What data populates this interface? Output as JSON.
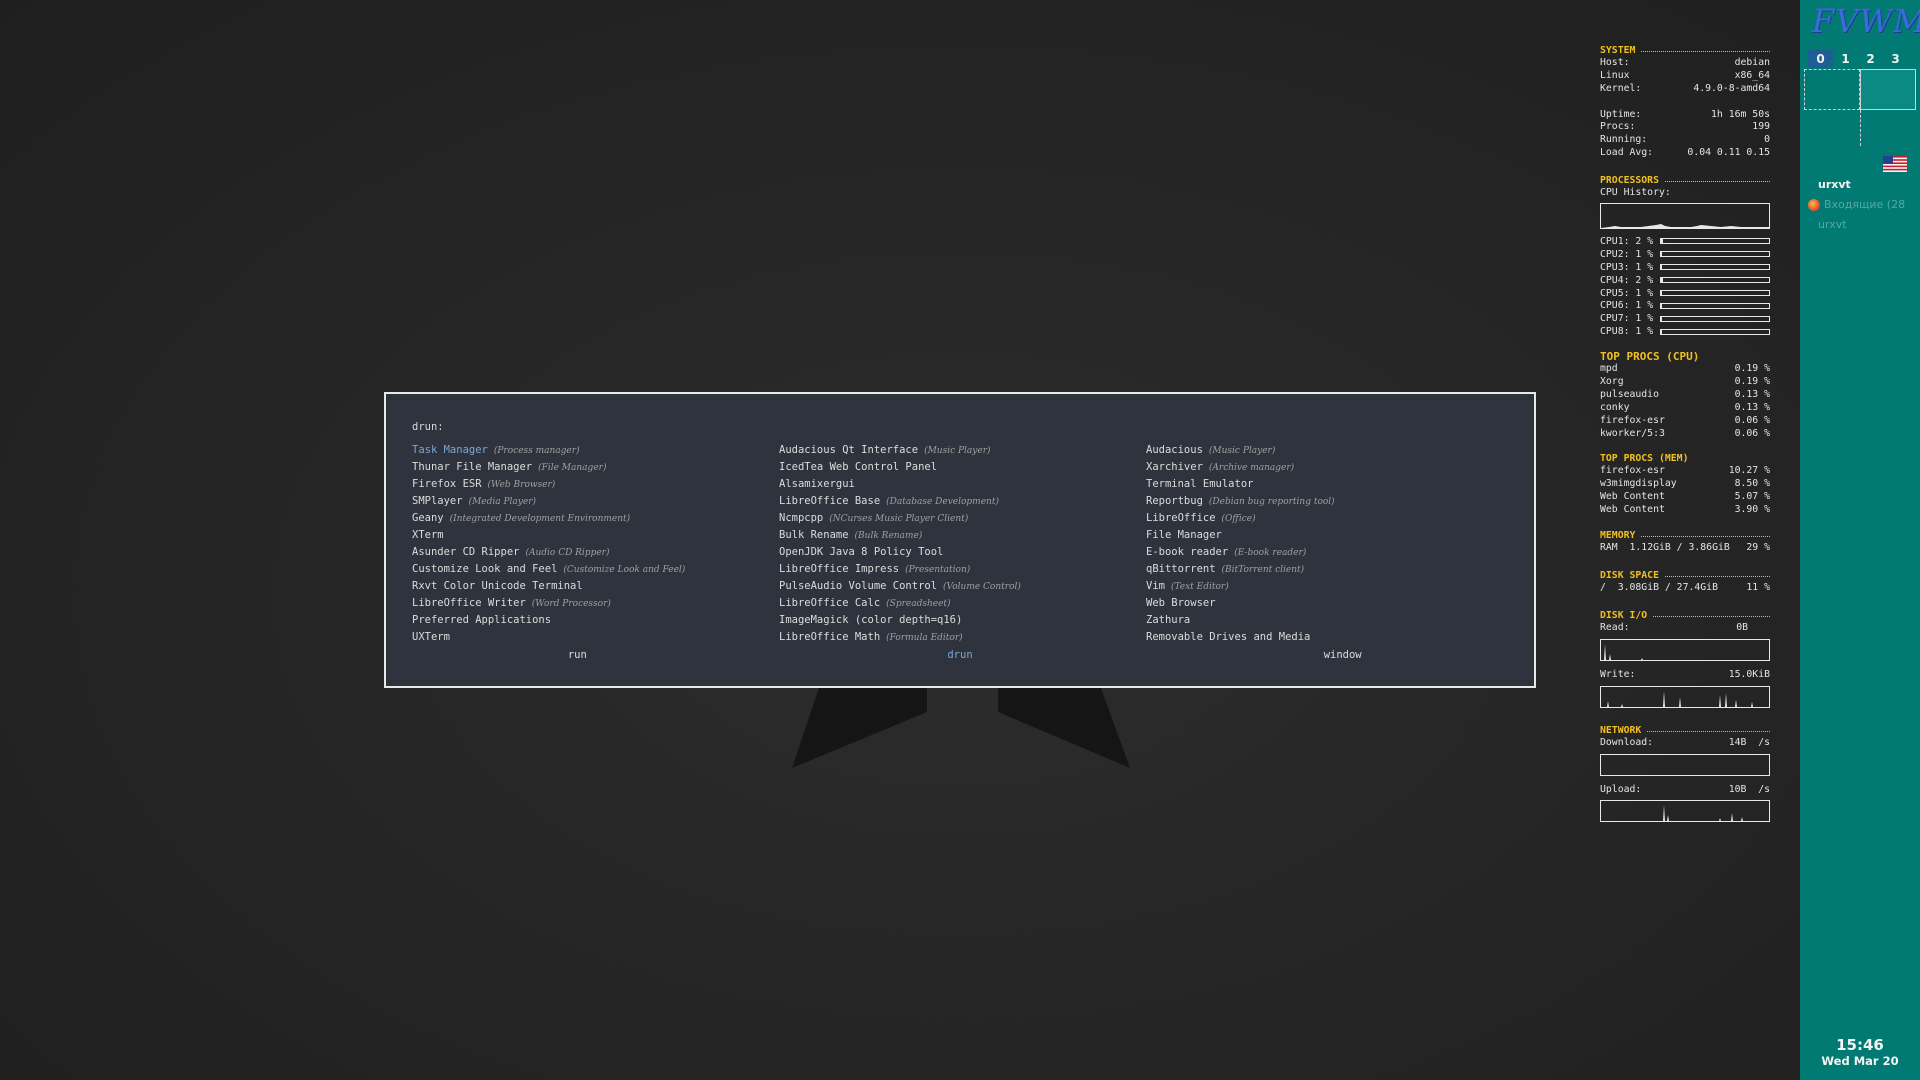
{
  "rofi": {
    "prompt": "drun:",
    "items": [
      {
        "name": "Task Manager",
        "desc": "(Process manager)",
        "selected": true
      },
      {
        "name": "Thunar File Manager",
        "desc": "(File Manager)"
      },
      {
        "name": "Firefox ESR",
        "desc": "(Web Browser)"
      },
      {
        "name": "SMPlayer",
        "desc": "(Media Player)"
      },
      {
        "name": "Geany",
        "desc": "(Integrated Development Environment)"
      },
      {
        "name": "XTerm",
        "desc": ""
      },
      {
        "name": "Asunder CD Ripper",
        "desc": "(Audio CD Ripper)"
      },
      {
        "name": "Customize Look and Feel",
        "desc": "(Customize Look and Feel)"
      },
      {
        "name": "Rxvt Color Unicode Terminal",
        "desc": ""
      },
      {
        "name": "LibreOffice Writer",
        "desc": "(Word Processor)"
      },
      {
        "name": "Preferred Applications",
        "desc": ""
      },
      {
        "name": "UXTerm",
        "desc": ""
      },
      {
        "name": "Audacious Qt Interface",
        "desc": "(Music Player)"
      },
      {
        "name": "IcedTea Web Control Panel",
        "desc": ""
      },
      {
        "name": "Alsamixergui",
        "desc": ""
      },
      {
        "name": "LibreOffice Base",
        "desc": "(Database Development)"
      },
      {
        "name": "Ncmpcpp",
        "desc": "(NCurses Music Player Client)"
      },
      {
        "name": "Bulk Rename",
        "desc": "(Bulk Rename)"
      },
      {
        "name": "OpenJDK Java 8 Policy Tool",
        "desc": ""
      },
      {
        "name": "LibreOffice Impress",
        "desc": "(Presentation)"
      },
      {
        "name": "PulseAudio Volume Control",
        "desc": "(Volume Control)"
      },
      {
        "name": "LibreOffice Calc",
        "desc": "(Spreadsheet)"
      },
      {
        "name": "ImageMagick (color depth=q16)",
        "desc": ""
      },
      {
        "name": "LibreOffice Math",
        "desc": "(Formula Editor)"
      },
      {
        "name": "Audacious",
        "desc": "(Music Player)"
      },
      {
        "name": "Xarchiver",
        "desc": "(Archive manager)"
      },
      {
        "name": "Terminal Emulator",
        "desc": ""
      },
      {
        "name": "Reportbug",
        "desc": "(Debian bug reporting tool)"
      },
      {
        "name": "LibreOffice",
        "desc": "(Office)"
      },
      {
        "name": "File Manager",
        "desc": ""
      },
      {
        "name": "E-book reader",
        "desc": "(E-book reader)"
      },
      {
        "name": "qBittorrent",
        "desc": "(BitTorrent client)"
      },
      {
        "name": "Vim",
        "desc": "(Text Editor)"
      },
      {
        "name": "Web Browser",
        "desc": ""
      },
      {
        "name": "Zathura",
        "desc": ""
      },
      {
        "name": "Removable Drives and Media",
        "desc": ""
      }
    ],
    "modes": [
      {
        "label": "run",
        "active": false
      },
      {
        "label": "drun",
        "active": true
      },
      {
        "label": "window",
        "active": false
      }
    ]
  },
  "conky": {
    "system": {
      "title": "SYSTEM",
      "rows": [
        [
          "Host:",
          "debian"
        ],
        [
          "Linux",
          "x86_64"
        ],
        [
          "Kernel:",
          "4.9.0-8-amd64"
        ]
      ],
      "rows2": [
        [
          "Uptime:",
          "1h 16m 50s"
        ],
        [
          "Procs:",
          "199"
        ],
        [
          "Running:",
          "0"
        ],
        [
          "Load Avg:",
          "0.04 0.11 0.15"
        ]
      ]
    },
    "processors": {
      "title": "PROCESSORS",
      "history_label": "CPU History:",
      "cpus": [
        {
          "label": "CPU1:",
          "value": "2 %",
          "pct": 2
        },
        {
          "label": "CPU2:",
          "value": "1 %",
          "pct": 1
        },
        {
          "label": "CPU3:",
          "value": "1 %",
          "pct": 1
        },
        {
          "label": "CPU4:",
          "value": "2 %",
          "pct": 2
        },
        {
          "label": "CPU5:",
          "value": "1 %",
          "pct": 1
        },
        {
          "label": "CPU6:",
          "value": "1 %",
          "pct": 1
        },
        {
          "label": "CPU7:",
          "value": "1 %",
          "pct": 1
        },
        {
          "label": "CPU8:",
          "value": "1 %",
          "pct": 1
        }
      ]
    },
    "top_cpu": {
      "title": "TOP PROCS (CPU)",
      "rows": [
        [
          "mpd",
          "0.19 %"
        ],
        [
          "Xorg",
          "0.19 %"
        ],
        [
          "pulseaudio",
          "0.13 %"
        ],
        [
          "conky",
          "0.13 %"
        ],
        [
          "firefox-esr",
          "0.06 %"
        ],
        [
          "kworker/5:3",
          "0.06 %"
        ]
      ]
    },
    "top_mem": {
      "title": "TOP PROCS (MEM)",
      "rows": [
        [
          "firefox-esr",
          "10.27 %"
        ],
        [
          "w3mimgdisplay",
          "8.50 %"
        ],
        [
          "Web Content",
          "5.07 %"
        ],
        [
          "Web Content",
          "3.90 %"
        ]
      ]
    },
    "memory": {
      "title": "MEMORY",
      "label": "RAM",
      "value": "1.12GiB / 3.86GiB",
      "pct": "29 %"
    },
    "disk_space": {
      "title": "DISK SPACE",
      "label": "/",
      "value": "3.08GiB / 27.4GiB",
      "pct": "11 %"
    },
    "disk_io": {
      "title": "DISK I/O",
      "read_label": "Read:",
      "read_value": "0B",
      "write_label": "Write:",
      "write_value": "15.0KiB"
    },
    "network": {
      "title": "NETWORK",
      "down_label": "Download:",
      "down_value": "14B  /s",
      "up_label": "Upload:",
      "up_value": "10B  /s"
    }
  },
  "panel": {
    "logo": "FVWM",
    "desks": [
      "0",
      "1",
      "2",
      "3"
    ],
    "active_desk": 0,
    "tasks": {
      "active": "urxvt",
      "firefox": "Входящие (28",
      "urxvt2": "urxvt"
    },
    "clock": {
      "time": "15:46",
      "date": "Wed Mar 20"
    }
  },
  "colors": {
    "panel_bg": "#007a73",
    "conky_header": "#f0c020",
    "rofi_bg": "#2f333d",
    "rofi_selected": "#7aa6d8"
  }
}
